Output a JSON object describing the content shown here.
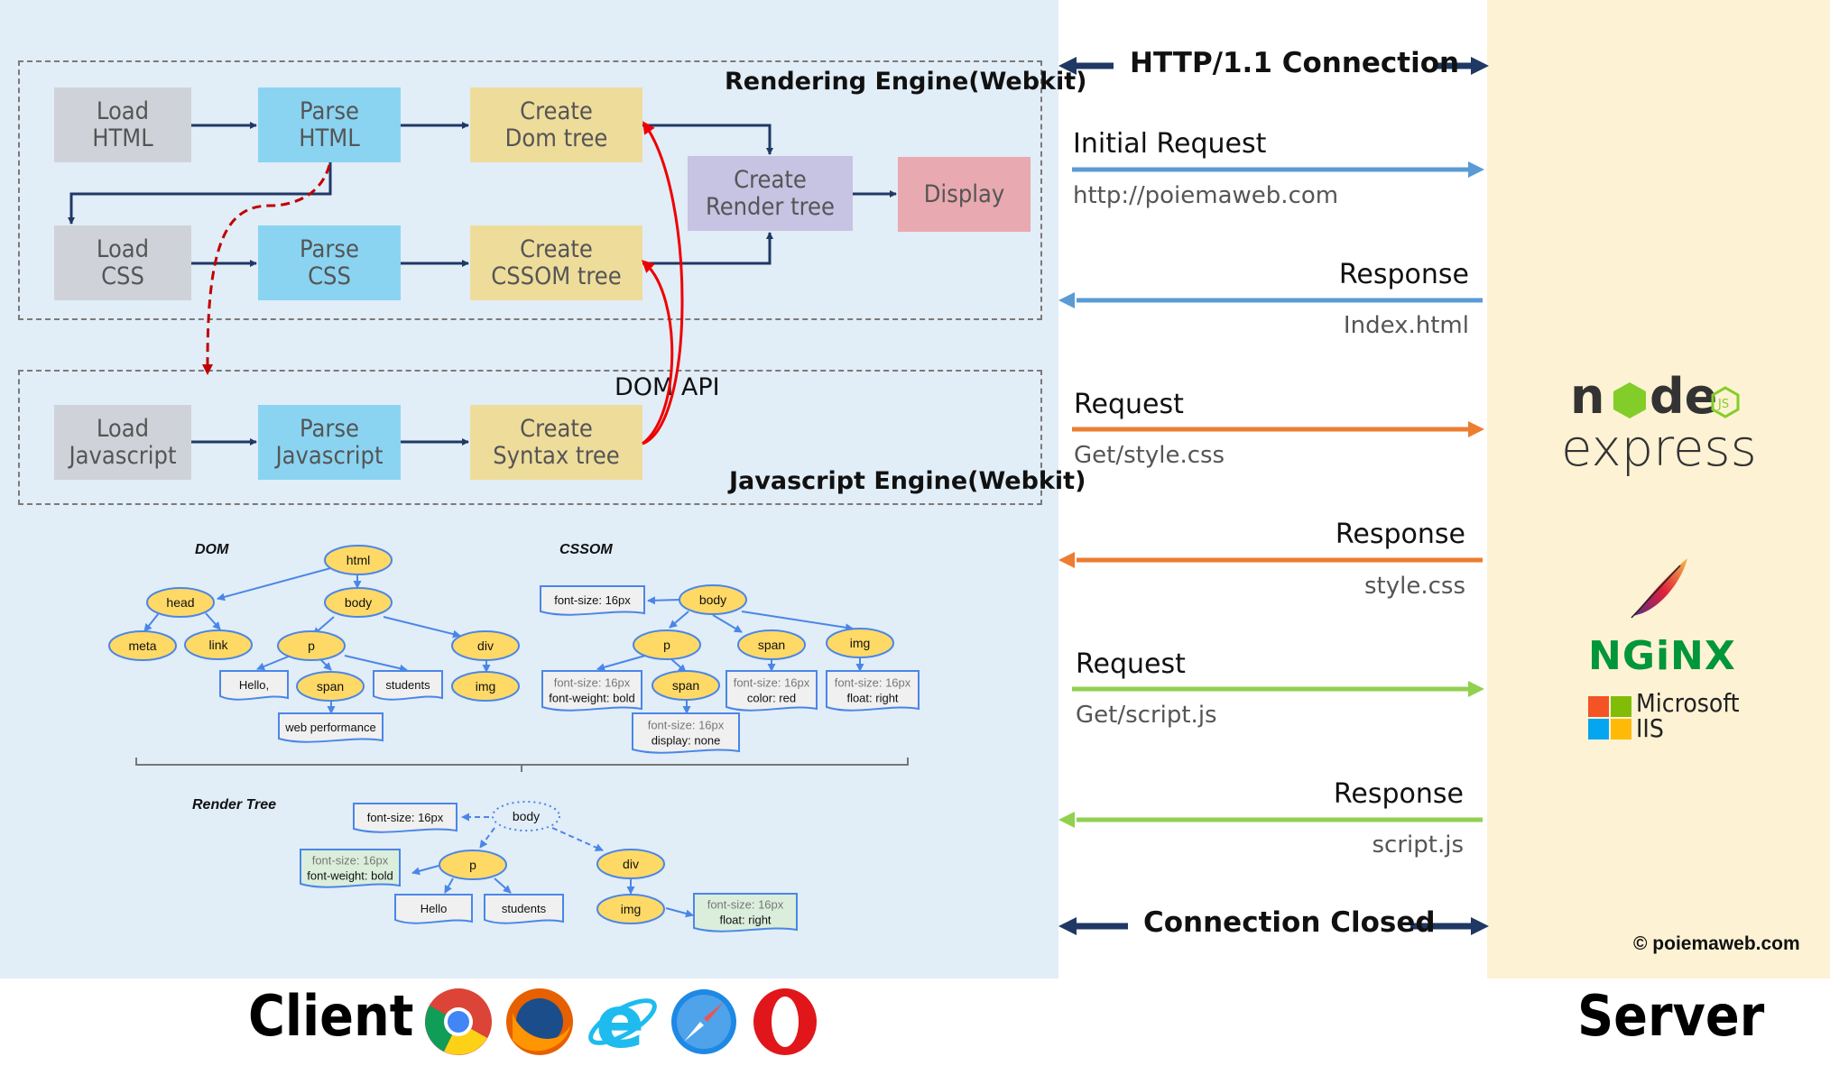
{
  "client": {
    "label": "Client",
    "browsers": [
      "chrome-icon",
      "firefox-icon",
      "ie-icon",
      "safari-icon",
      "opera-icon"
    ],
    "rendering_engine": {
      "label": "Rendering Engine(Webkit)",
      "boxes": {
        "load_html": "Load\nHTML",
        "parse_html": "Parse\nHTML",
        "create_dom": "Create\nDom tree",
        "load_css": "Load\nCSS",
        "parse_css": "Parse\nCSS",
        "create_cssom": "Create\nCSSOM tree",
        "create_render": "Create\nRender tree",
        "display": "Display"
      }
    },
    "js_engine": {
      "label": "Javascript Engine(Webkit)",
      "dom_api": "DOM API",
      "boxes": {
        "load_js": "Load\nJavascript",
        "parse_js": "Parse\nJavascript",
        "create_syntax": "Create\nSyntax  tree"
      }
    },
    "trees": {
      "dom_title": "DOM",
      "cssom_title": "CSSOM",
      "render_title": "Render Tree",
      "dom": {
        "nodes": {
          "html": "html",
          "head": "head",
          "body": "body",
          "meta": "meta",
          "link": "link",
          "p": "p",
          "div": "div",
          "span": "span",
          "img": "img"
        },
        "texts": {
          "hello": "Hello,",
          "students": "students",
          "webperf": "web performance"
        }
      },
      "cssom": {
        "nodes": {
          "body": "body",
          "p": "p",
          "span1": "span",
          "img": "img",
          "span2": "span"
        },
        "rules": {
          "body": [
            "font-size: 16px"
          ],
          "p": [
            "font-size: 16px",
            "font-weight: bold"
          ],
          "span1": [
            "font-size: 16px",
            "color: red"
          ],
          "img": [
            "font-size: 16px",
            "float: right"
          ],
          "span2": [
            "font-size: 16px",
            "display: none"
          ]
        }
      },
      "render": {
        "nodes": {
          "body": "body",
          "p": "p",
          "div": "div",
          "img": "img"
        },
        "texts": {
          "hello": "Hello",
          "students": "students"
        },
        "rules": {
          "body": [
            "font-size: 16px"
          ],
          "p": [
            "font-size: 16px",
            "font-weight: bold"
          ],
          "img": [
            "font-size: 16px",
            "float: right"
          ]
        }
      }
    }
  },
  "http": {
    "connection_title": "HTTP/1.1 Connection",
    "closed_title": "Connection Closed",
    "messages": [
      {
        "label": "Initial Request",
        "sub": "http://poiemaweb.com",
        "direction": "right",
        "color": "#5b9bd5"
      },
      {
        "label": "Response",
        "sub": "Index.html",
        "direction": "left",
        "color": "#5b9bd5"
      },
      {
        "label": "Request",
        "sub": "Get/style.css",
        "direction": "right",
        "color": "#ed7d31"
      },
      {
        "label": "Response",
        "sub": "style.css",
        "direction": "left",
        "color": "#ed7d31"
      },
      {
        "label": "Request",
        "sub": "Get/script.js",
        "direction": "right",
        "color": "#92d050"
      },
      {
        "label": "Response",
        "sub": "script.js",
        "direction": "left",
        "color": "#92d050"
      }
    ]
  },
  "server": {
    "label": "Server",
    "logos": {
      "node": "node",
      "express": "express",
      "nginx": "NGiNX",
      "ms_line1": "Microsoft",
      "ms_line2": "IIS"
    },
    "copyright": "© poiemaweb.com"
  },
  "colors": {
    "client_bg": "#e1edf7",
    "server_bg": "#fdf2d3",
    "arrow_dark": "#1f3864",
    "dom_api_arrow": "#ee0000",
    "node_fill": "#ffd966",
    "node_stroke": "#4a86e8",
    "nginx_green": "#009639"
  }
}
